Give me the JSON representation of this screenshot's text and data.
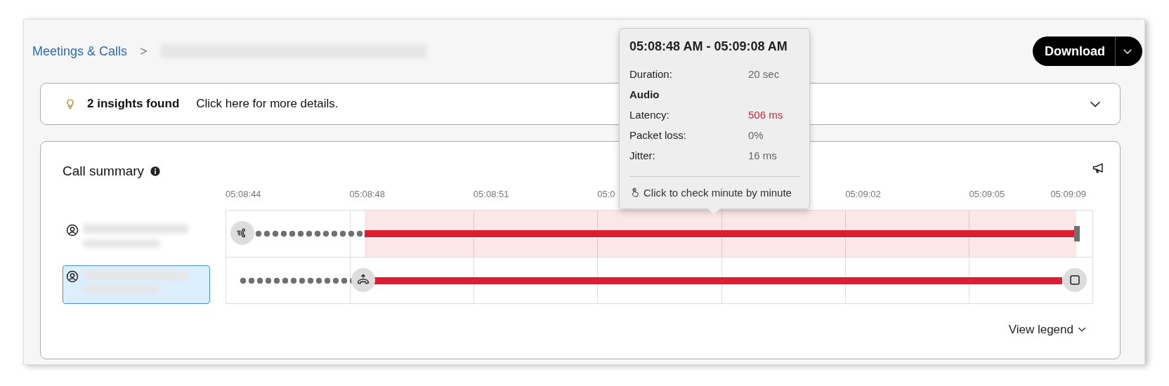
{
  "breadcrumb": {
    "link": "Meetings & Calls",
    "separator": ">"
  },
  "download_button": {
    "label": "Download"
  },
  "insights": {
    "count_text": "2 insights found",
    "link_text": "Click here for more details."
  },
  "call_summary": {
    "title": "Call summary",
    "participants": [
      {
        "selected": false
      },
      {
        "selected": true
      }
    ],
    "ticks": [
      "05:08:44",
      "05:08:48",
      "05:08:51",
      "05:0",
      "05:09:02",
      "05:09:05",
      "05:09:09"
    ],
    "rows": [
      {
        "highlighted": true,
        "markers": [
          {
            "kind": "ringing"
          },
          {
            "kind": "cap"
          }
        ]
      },
      {
        "highlighted": false,
        "markers": [
          {
            "kind": "answer"
          },
          {
            "kind": "stop"
          }
        ]
      }
    ],
    "legend_link": "View legend"
  },
  "tooltip": {
    "title": "05:08:48 AM - 05:09:08 AM",
    "items": [
      {
        "kind": "metric",
        "label": "Duration:",
        "value": "20 sec",
        "alert": false
      },
      {
        "kind": "heading",
        "label": "Audio"
      },
      {
        "kind": "metric",
        "label": "Latency:",
        "value": "506 ms",
        "alert": true
      },
      {
        "kind": "metric",
        "label": "Packet loss:",
        "value": "0%",
        "alert": false
      },
      {
        "kind": "metric",
        "label": "Jitter:",
        "value": "16 ms",
        "alert": false
      }
    ],
    "footer": "Click to check minute by minute"
  }
}
